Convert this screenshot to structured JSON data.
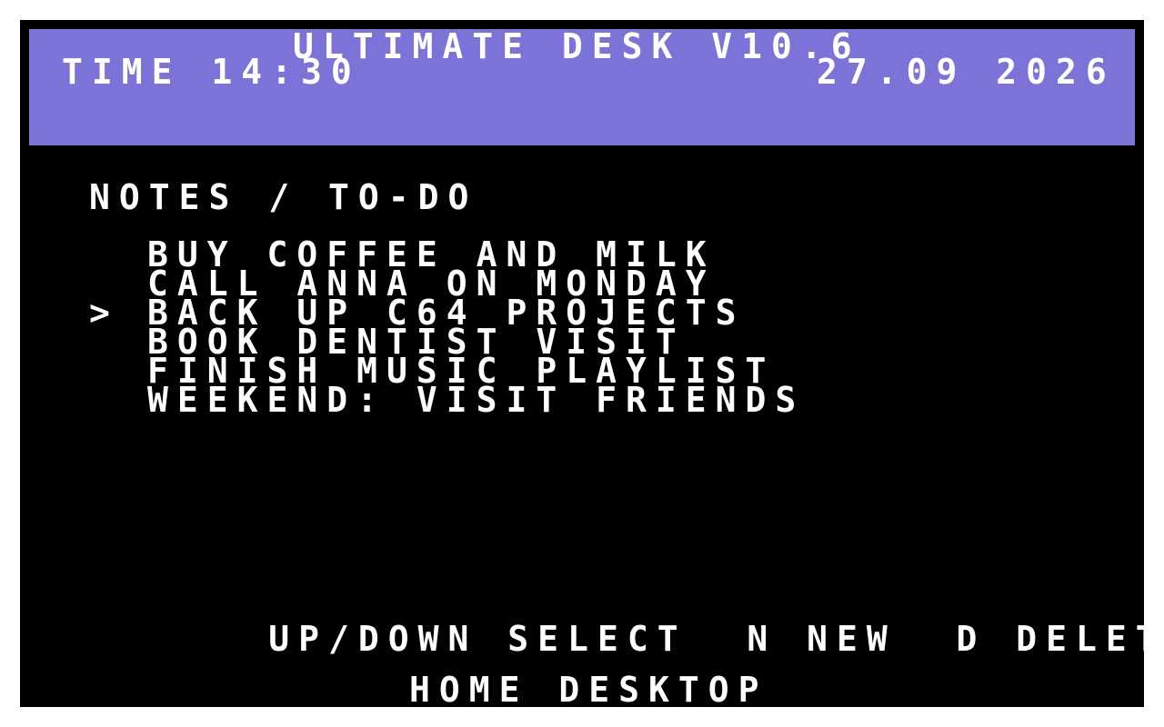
{
  "header": {
    "app_title": "ULTIMATE DESK V10.6",
    "time": "TIME 14:30",
    "date": "27.09 2026",
    "bg_color": "#7b73d8"
  },
  "notes": {
    "title": "NOTES / TO-DO",
    "cursor_symbol": ">",
    "selected_index": 2,
    "items": [
      "BUY COFFEE AND MILK",
      "CALL ANNA ON MONDAY",
      "BACK UP C64 PROJECTS",
      "BOOK DENTIST VISIT",
      "FINISH MUSIC PLAYLIST",
      "WEEKEND: VISIT FRIENDS"
    ]
  },
  "help": {
    "select": "UP/DOWN SELECT",
    "new": "N NEW",
    "delete": "D DELETE"
  },
  "footer": {
    "label": "HOME DESKTOP"
  }
}
